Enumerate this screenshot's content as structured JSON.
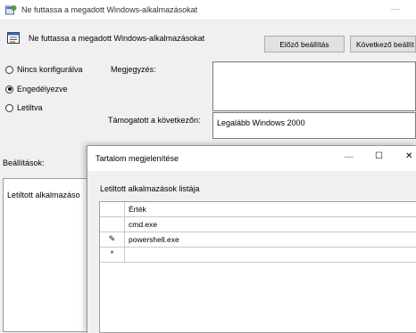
{
  "window": {
    "title": "Ne futtassa a megadott Windows-alkalmazásokat",
    "minimize_glyph": "—"
  },
  "header": {
    "policy_title": "Ne futtassa a megadott Windows-alkalmazásokat",
    "prev_button": "Előző beállítás",
    "next_button": "Következő beállít"
  },
  "options": {
    "not_configured": "Nincs konfigurálva",
    "enabled": "Engedélyezve",
    "disabled": "Letiltva",
    "selected": "enabled"
  },
  "labels": {
    "comment": "Megjegyzés:",
    "supported_on": "Támogatott a következőn:",
    "supported_value": "Legalább Windows 2000",
    "settings": "Beállítások:",
    "disallowed_apps": "Letiltott alkalmazáso"
  },
  "dialog": {
    "title": "Tartalom megjelenítése",
    "subtitle": "Letiltott alkalmazások listája",
    "column_header": "Érték",
    "rows": [
      {
        "marker": "",
        "value": "cmd.exe"
      },
      {
        "marker": "✎",
        "value": "powershell.exe"
      },
      {
        "marker": "*",
        "value": ""
      }
    ],
    "minimize": "—",
    "maximize": "☐",
    "close": "✕"
  },
  "icons": {
    "app": "policy-settings-icon",
    "header": "policy-document-icon",
    "edit": "pencil-icon",
    "new_row": "asterisk-icon"
  }
}
